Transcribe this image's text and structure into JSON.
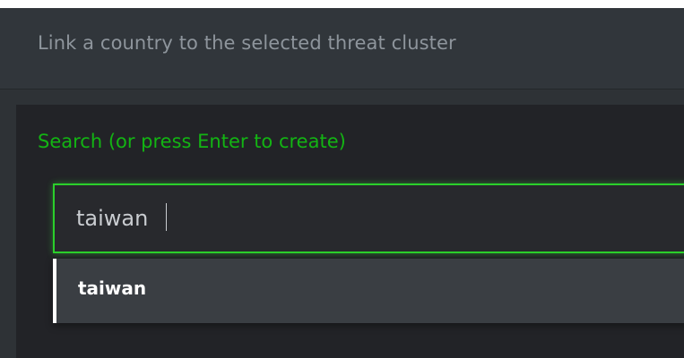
{
  "dialog": {
    "title": "Link a country to the selected threat cluster"
  },
  "search": {
    "label": "Search (or press Enter to create)",
    "value": "taiwan",
    "placeholder": ""
  },
  "suggestions": [
    {
      "label": "taiwan"
    }
  ],
  "colors": {
    "accent": "#13b413",
    "focus_border": "#2bcf2b",
    "background": "#222327"
  }
}
